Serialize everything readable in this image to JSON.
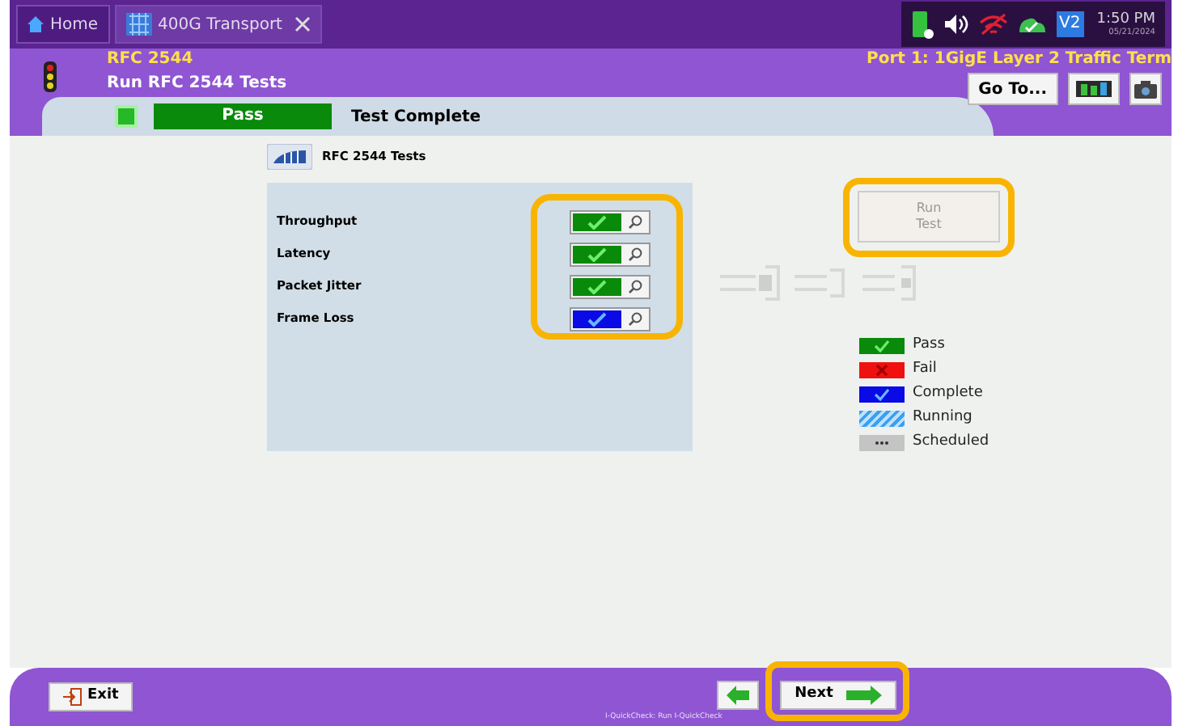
{
  "tabs": [
    {
      "label": "Home",
      "kind": "home",
      "selected": false
    },
    {
      "label": "400G Transport",
      "kind": "app",
      "selected": true
    }
  ],
  "status": {
    "time": "1:50 PM",
    "date": "05/21/2024",
    "badge": "V2"
  },
  "header": {
    "module": "RFC 2544",
    "title": "Run RFC 2544 Tests",
    "port": "Port 1: 1GigE Layer 2 Traffic Term",
    "goto": "Go To..."
  },
  "result_bar": {
    "result": "Pass",
    "message": "Test Complete"
  },
  "panel": {
    "title": "RFC 2544 Tests",
    "tests": [
      {
        "name": "Throughput",
        "kind": "pass"
      },
      {
        "name": "Latency",
        "kind": "pass"
      },
      {
        "name": "Packet Jitter",
        "kind": "pass"
      },
      {
        "name": "Frame Loss",
        "kind": "complete"
      }
    ]
  },
  "run_button": {
    "label": "Run Test",
    "disabled": true
  },
  "legend": [
    {
      "label": "Pass",
      "kind": "pass"
    },
    {
      "label": "Fail",
      "kind": "fail"
    },
    {
      "label": "Complete",
      "kind": "complete"
    },
    {
      "label": "Running",
      "kind": "running"
    },
    {
      "label": "Scheduled",
      "kind": "scheduled"
    }
  ],
  "footer": {
    "exit": "Exit",
    "next": "Next",
    "hint": "I-QuickCheck: Run I-QuickCheck"
  }
}
